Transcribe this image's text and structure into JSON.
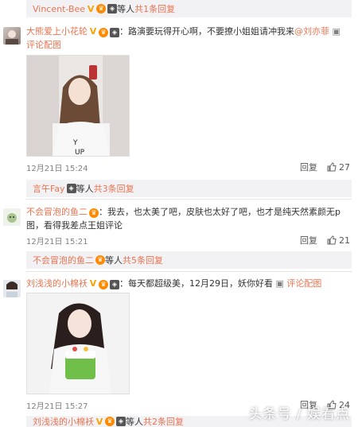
{
  "top_reply": {
    "user": "Vincent-Bee",
    "suffix": " 等人 ",
    "count_link": "共1条回复"
  },
  "comment1": {
    "user": "大熊爱上小花轮",
    "text_part1": "：路演要玩得开心啊，不要撩小姐姐请冲我来",
    "mention": "@刘亦菲",
    "action": "评论配图",
    "time": "12月21日 15:24",
    "reply_label": "回复",
    "likes": "27"
  },
  "reply2": {
    "user": "言午Fay",
    "suffix": " 等人 ",
    "count_link": "共3条回复"
  },
  "comment2": {
    "user": "不会冒泡的鱼二",
    "text": "：我去，也太美了吧，皮肤也太好了吧，也才是纯天然素颜无p图，看得我差点王姐评论",
    "time": "12月21日 15:21",
    "reply_label": "回复",
    "likes": "21"
  },
  "reply3": {
    "user": "不会冒泡的鱼二",
    "suffix": " 等人 ",
    "count_link": "共5条回复"
  },
  "comment3": {
    "user": "刘浅浅的小棉袄",
    "text": "：每天都超级美，12月29日，妖你好看",
    "action": "评论配图",
    "time": "12月21日 15:27",
    "reply_label": "回复",
    "likes": "24"
  },
  "bottom_reply": {
    "user": "刘浅浅的小棉袄",
    "suffix": " 等人 ",
    "count_link": "共2条回复"
  },
  "watermark": "头条号 / 娱看点",
  "colors": {
    "link": "#eb7350",
    "bar": "#f2f2f5"
  }
}
